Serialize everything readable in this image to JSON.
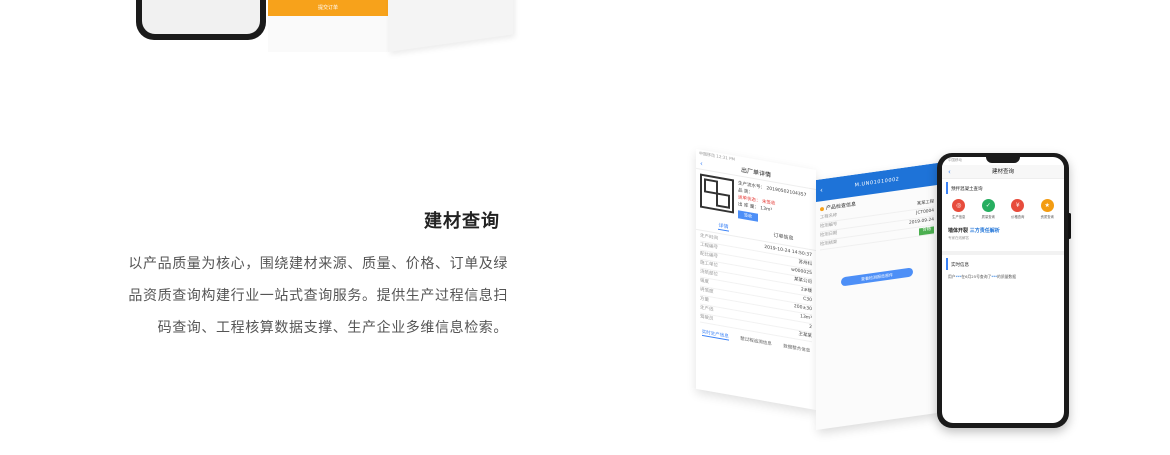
{
  "top_mockup": {
    "button_label": "提交订单"
  },
  "feature": {
    "title": "建材查询",
    "description_lines": [
      "以产品质量为核心，围绕建材来源、质量、价格、订单及绿",
      "品资质查询构建行业一站式查询服务。提供生产过程信息扫",
      "码查询、工程核算数据支撑、生产企业多维信息检索。"
    ]
  },
  "left_panel": {
    "status": "中国移动  12:31 PM",
    "header": "出厂单详情",
    "info_lines": [
      "生产流水号： 20190502104357",
      "品    类：",
      "运单状态：  未签收",
      "出 库 量：  13m³"
    ],
    "button": "签收",
    "tabs": [
      "详情",
      "订单信息"
    ],
    "rows": [
      {
        "k": "生产时间",
        "v": "2019-10-24 14:50:37"
      },
      {
        "k": "工程编号",
        "v": "苏州科"
      },
      {
        "k": "配比编号",
        "v": "w000025"
      },
      {
        "k": "施工单位",
        "v": "某某公司"
      },
      {
        "k": "浇筑部位",
        "v": "2#楼"
      },
      {
        "k": "强度",
        "v": "C30"
      },
      {
        "k": "坍落度",
        "v": "200±30"
      },
      {
        "k": "方量",
        "v": "13m³"
      },
      {
        "k": "生产线",
        "v": "2"
      },
      {
        "k": "驾驶员",
        "v": "王某某"
      }
    ],
    "bottom_tabs": [
      "实时生产信息",
      "整过程追溯信息",
      "数据整合信息"
    ]
  },
  "mid_panel": {
    "header": "M.UN01010002",
    "section": "产品检查信息",
    "rows": [
      {
        "k": "工程名称",
        "v": "某某工程"
      },
      {
        "k": "检测编号",
        "v": "JCT0004"
      },
      {
        "k": "检测日期",
        "v": "2019-09-24"
      },
      {
        "k": "检测结果",
        "v": "合格"
      }
    ],
    "button": "查看检测报告原件"
  },
  "phone": {
    "status": "中国移动",
    "header": "建材查询",
    "section_title": "预拌混凝土查询",
    "icons": [
      {
        "name": "生产信息",
        "color": "#e74c3c",
        "glyph": "◎"
      },
      {
        "name": "质量查询",
        "color": "#27ae60",
        "glyph": "✓"
      },
      {
        "name": "价格查询",
        "color": "#e74c3c",
        "glyph": "¥"
      },
      {
        "name": "资质查询",
        "color": "#f39c12",
        "glyph": "★"
      }
    ],
    "banner_prefix": "墙体开裂",
    "banner_highlight": "三方责任解析",
    "banner_sub": "专家在线解答",
    "news_title": "实时信息",
    "news_text_prefix": "用户",
    "news_text_mid": "在6月25号查询了",
    "news_text_suffix": "的质量数据"
  }
}
